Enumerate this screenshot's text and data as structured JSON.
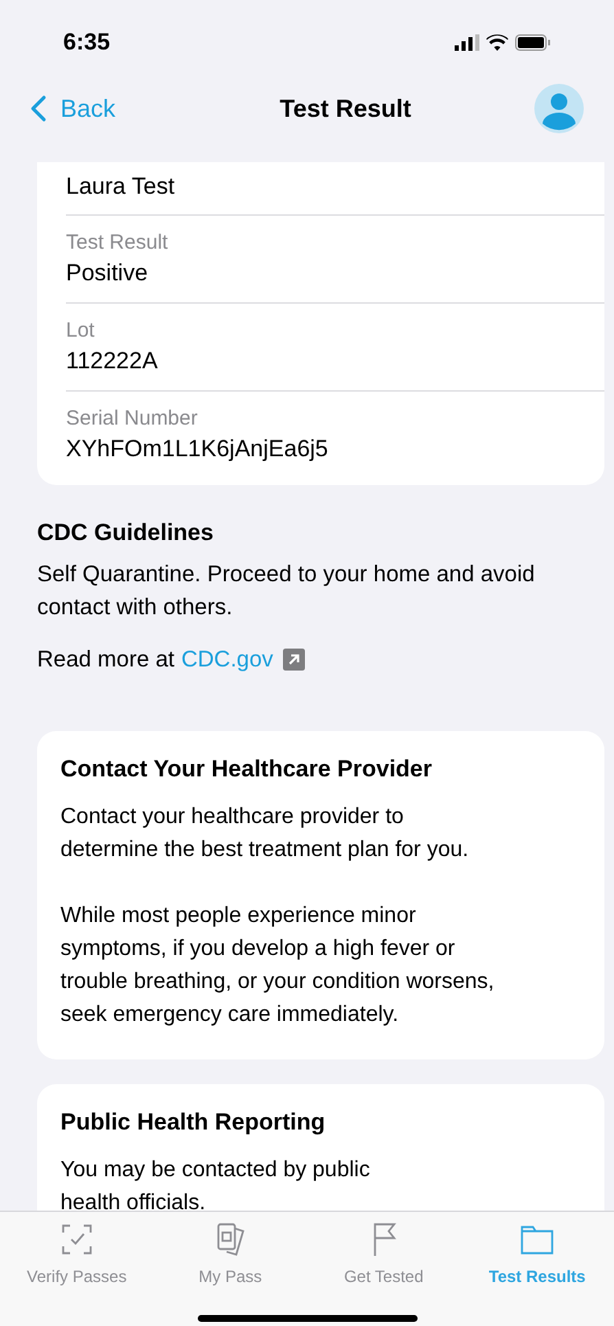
{
  "status_bar": {
    "time": "6:35"
  },
  "nav": {
    "back": "Back",
    "title": "Test Result"
  },
  "fields": [
    {
      "value": "Laura Test"
    },
    {
      "label": "Test Result",
      "value": "Positive"
    },
    {
      "label": "Lot",
      "value": "112222A"
    },
    {
      "label": "Serial Number",
      "value": "XYhFOm1L1K6jAnjEa6j5"
    }
  ],
  "guidelines": {
    "title": "CDC Guidelines",
    "text": "Self Quarantine. Proceed to your home and avoid contact with others.",
    "read_more": "Read more at",
    "link": "CDC.gov"
  },
  "cards": [
    {
      "title": "Contact Your Healthcare Provider",
      "paragraphs": [
        "Contact your healthcare provider to\ndetermine the best treatment plan for you.",
        "While most people experience minor\nsymptoms, if you develop a high fever or\ntrouble breathing, or your condition worsens,\nseek emergency care immediately."
      ]
    },
    {
      "title": "Public Health Reporting",
      "paragraphs": [
        "You may be contacted by public\nhealth officials."
      ]
    }
  ],
  "tabs": [
    {
      "label": "Verify Passes",
      "kind": "verify",
      "selected": false
    },
    {
      "label": "My Pass",
      "kind": "pass",
      "selected": false
    },
    {
      "label": "Get Tested",
      "kind": "flag",
      "selected": false
    },
    {
      "label": "Test Results",
      "kind": "folder",
      "selected": true
    }
  ]
}
